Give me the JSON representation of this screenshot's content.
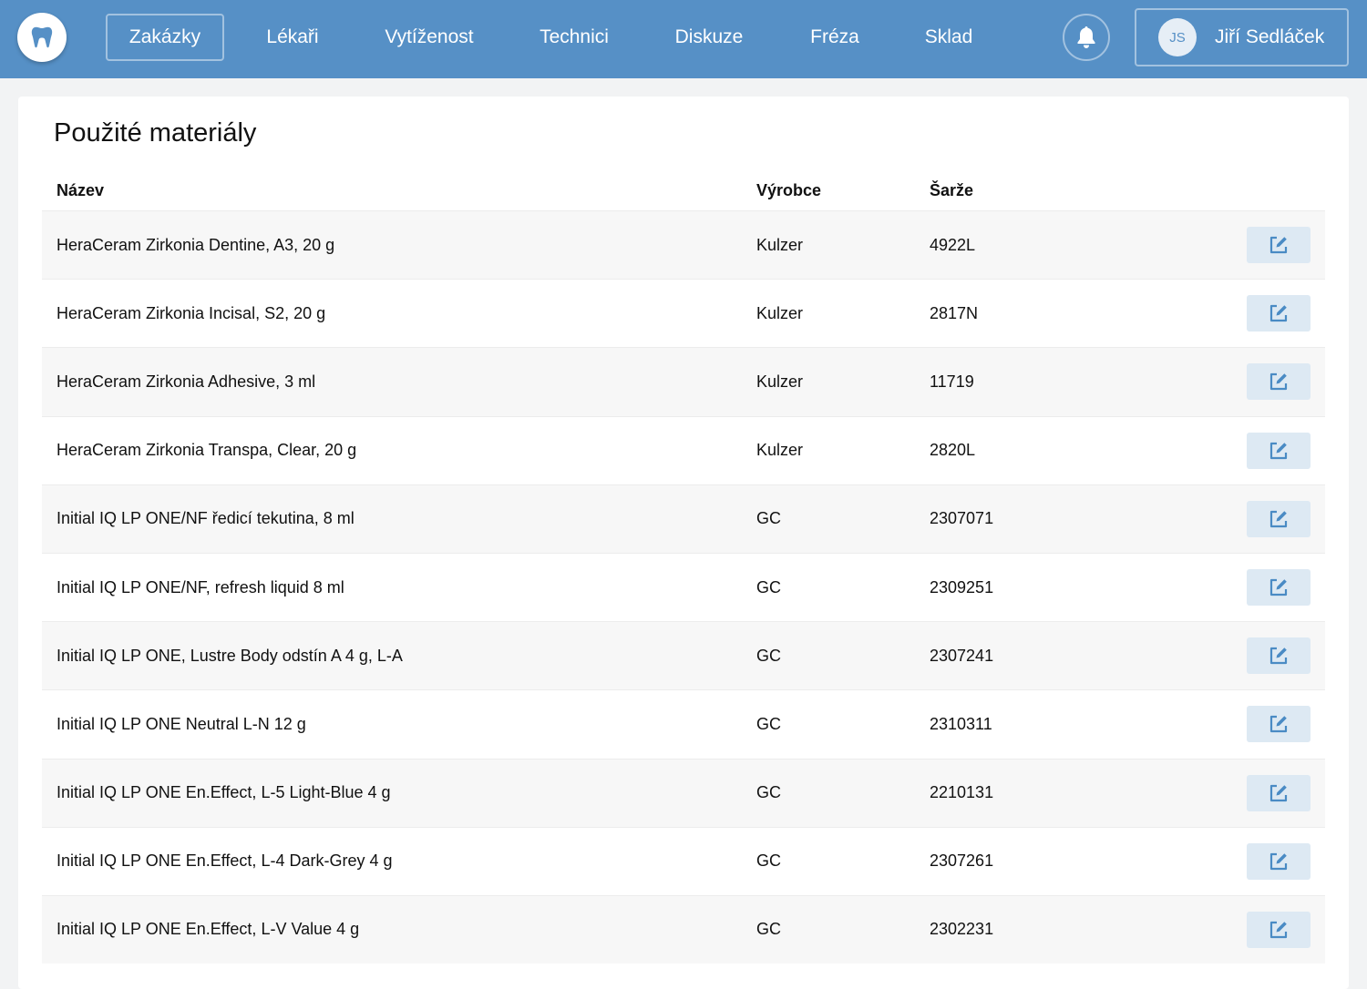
{
  "nav": {
    "items": [
      {
        "label": "Zakázky",
        "active": true
      },
      {
        "label": "Lékaři",
        "active": false
      },
      {
        "label": "Vytíženost",
        "active": false
      },
      {
        "label": "Technici",
        "active": false
      },
      {
        "label": "Diskuze",
        "active": false
      },
      {
        "label": "Fréza",
        "active": false
      },
      {
        "label": "Sklad",
        "active": false
      }
    ],
    "logo_icon": "tooth-icon",
    "bell_icon": "bell-icon"
  },
  "user": {
    "initials": "JS",
    "name": "Jiří Sedláček"
  },
  "colors": {
    "header": "#5690c6",
    "accent": "#5690c6",
    "button_bg": "#dde9f3"
  },
  "page": {
    "title": "Použité materiály"
  },
  "table": {
    "headers": {
      "name": "Název",
      "manufacturer": "Výrobce",
      "batch": "Šarže"
    },
    "rows": [
      {
        "name": "HeraCeram Zirkonia Dentine, A3, 20 g",
        "manufacturer": "Kulzer",
        "batch": "4922L"
      },
      {
        "name": "HeraCeram Zirkonia Incisal, S2, 20 g",
        "manufacturer": "Kulzer",
        "batch": "2817N"
      },
      {
        "name": "HeraCeram Zirkonia Adhesive, 3 ml",
        "manufacturer": "Kulzer",
        "batch": "11719"
      },
      {
        "name": "HeraCeram Zirkonia Transpa, Clear, 20 g",
        "manufacturer": "Kulzer",
        "batch": "2820L"
      },
      {
        "name": "Initial IQ LP ONE/NF ředicí tekutina, 8 ml",
        "manufacturer": "GC",
        "batch": "2307071"
      },
      {
        "name": "Initial IQ LP ONE/NF, refresh liquid 8 ml",
        "manufacturer": "GC",
        "batch": "2309251"
      },
      {
        "name": "Initial IQ LP ONE, Lustre Body odstín A 4 g, L-A",
        "manufacturer": "GC",
        "batch": "2307241"
      },
      {
        "name": "Initial IQ LP ONE Neutral L-N 12 g",
        "manufacturer": "GC",
        "batch": "2310311"
      },
      {
        "name": "Initial IQ LP ONE En.Effect, L-5 Light-Blue 4 g",
        "manufacturer": "GC",
        "batch": "2210131"
      },
      {
        "name": "Initial IQ LP ONE En.Effect, L-4 Dark-Grey 4 g",
        "manufacturer": "GC",
        "batch": "2307261"
      },
      {
        "name": "Initial IQ LP ONE En.Effect, L-V Value 4 g",
        "manufacturer": "GC",
        "batch": "2302231"
      }
    ],
    "edit_icon": "edit-icon"
  }
}
